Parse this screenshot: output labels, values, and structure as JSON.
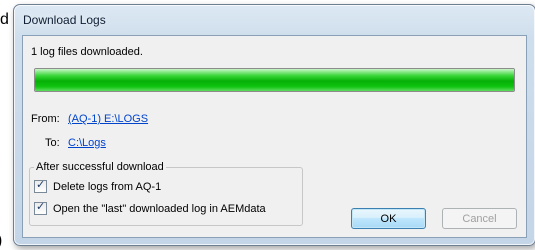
{
  "background": {
    "left_glyph": "d",
    "bottom_glyph": ")"
  },
  "dialog": {
    "title": "Download Logs",
    "message": "1 log files downloaded.",
    "progress": 1.0,
    "from_label": "From:",
    "from_value": "(AQ-1) E:\\LOGS",
    "to_label": "To:",
    "to_value": "C:\\Logs",
    "group_label": "After successful download",
    "options": [
      {
        "label": "Delete logs from AQ-1",
        "checked": true
      },
      {
        "label": "Open the \"last\" downloaded log in AEMdata",
        "checked": true
      }
    ],
    "buttons": {
      "ok": "OK",
      "cancel": "Cancel"
    }
  },
  "colors": {
    "progress_fill": "#06b006",
    "link": "#0044cc",
    "dialog_bg": "#f0f0f0"
  }
}
